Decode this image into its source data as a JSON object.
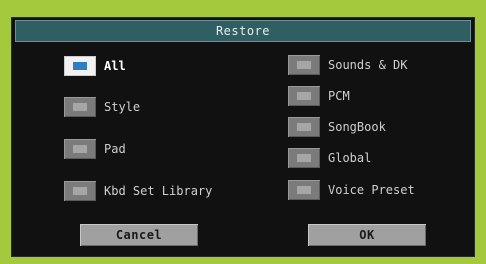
{
  "dialog": {
    "title": "Restore",
    "options": [
      {
        "label": "All",
        "checked": true
      },
      {
        "label": "Style",
        "checked": false
      },
      {
        "label": "Pad",
        "checked": false
      },
      {
        "label": "Kbd Set Library",
        "checked": false
      },
      {
        "label": "Sounds & DK",
        "checked": false
      },
      {
        "label": "PCM",
        "checked": false
      },
      {
        "label": "SongBook",
        "checked": false
      },
      {
        "label": "Global",
        "checked": false
      },
      {
        "label": "Voice Preset",
        "checked": false
      }
    ],
    "buttons": {
      "cancel": "Cancel",
      "ok": "OK"
    }
  },
  "colors": {
    "background": "#a5c93d",
    "titlebar": "#2f5e63",
    "checked_mark": "#2f7dc2",
    "button": "#a0a0a0"
  }
}
